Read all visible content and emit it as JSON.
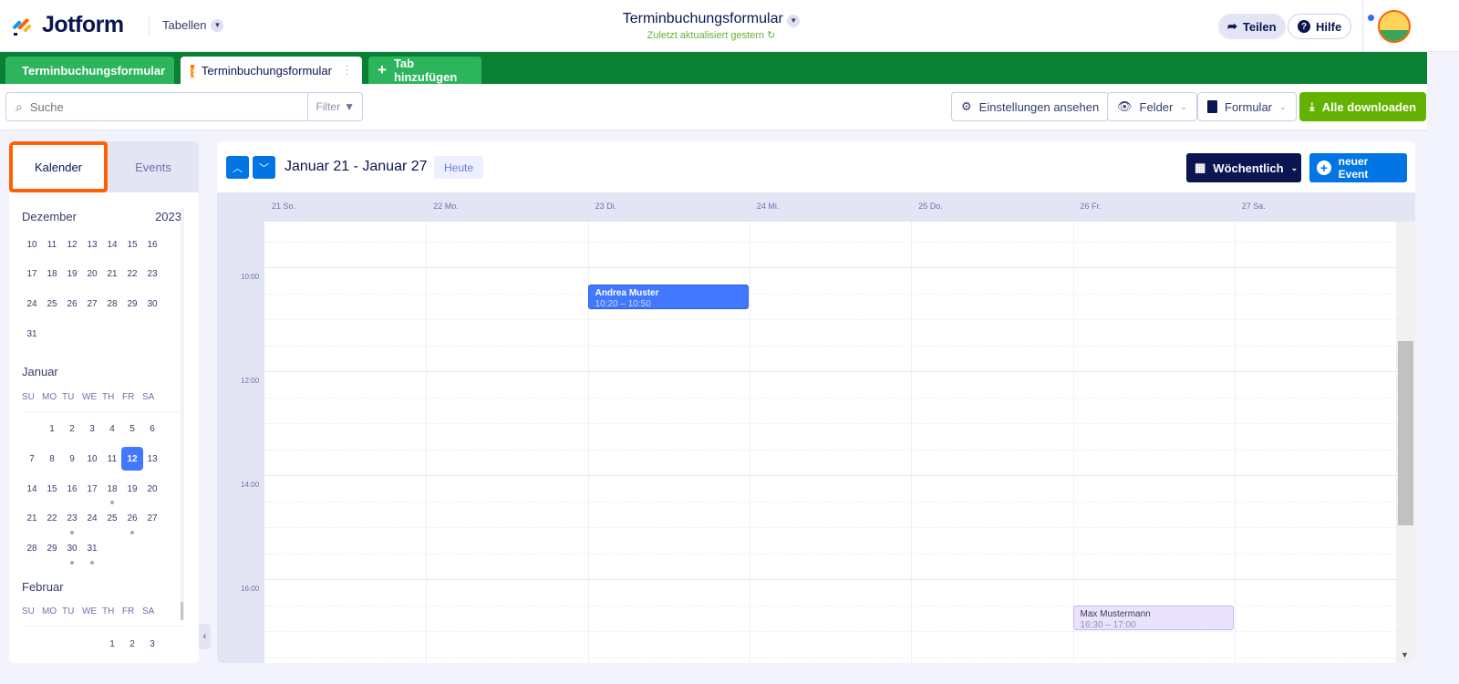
{
  "header": {
    "brand": "Jotform",
    "menu": "Tabellen",
    "title": "Terminbuchungsformular",
    "subtitle": "Zuletzt aktualisiert gestern",
    "share": "Teilen",
    "help": "Hilfe"
  },
  "tabs": [
    {
      "label": "Terminbuchungsformular",
      "icon": "grid-icon"
    },
    {
      "label": "Terminbuchungsformular",
      "icon": "calendar-icon",
      "active": true
    },
    {
      "label": "Tab hinzufügen",
      "icon": "plus-icon"
    }
  ],
  "toolbar": {
    "search_placeholder": "Suche",
    "filter": "Filter",
    "settings": "Einstellungen ansehen",
    "fields": "Felder",
    "form": "Formular",
    "download": "Alle downloaden"
  },
  "sidebar": {
    "tabs": [
      "Kalender",
      "Events"
    ],
    "weekdays": [
      "SU",
      "MO",
      "TU",
      "WE",
      "TH",
      "FR",
      "SA"
    ],
    "months": [
      {
        "name": "Dezember",
        "year": "2023",
        "show_weekdays": false,
        "offset": 0,
        "days": [
          10,
          11,
          12,
          13,
          14,
          15,
          16,
          17,
          18,
          19,
          20,
          21,
          22,
          23,
          24,
          25,
          26,
          27,
          28,
          29,
          30,
          31
        ]
      },
      {
        "name": "Januar",
        "show_weekdays": true,
        "offset": 1,
        "days": [
          1,
          2,
          3,
          4,
          5,
          6,
          7,
          8,
          9,
          10,
          11,
          12,
          13,
          14,
          15,
          16,
          17,
          18,
          19,
          20,
          21,
          22,
          23,
          24,
          25,
          26,
          27,
          28,
          29,
          30,
          31
        ],
        "selected": 12,
        "event_days": [
          18,
          23,
          26,
          30,
          31
        ]
      },
      {
        "name": "Februar",
        "show_weekdays": true,
        "offset": 4,
        "days": [
          1,
          2,
          3
        ]
      }
    ]
  },
  "calendar": {
    "range": "Januar 21 - Januar 27",
    "today": "Heute",
    "view": "Wöchentlich",
    "new_event": "neuer Event",
    "days": [
      "21 So.",
      "22 Mo.",
      "23 Di.",
      "24 Mi.",
      "25 Do.",
      "26 Fr.",
      "27 Sa."
    ],
    "hour_labels": [
      "10:00",
      "12:00",
      "14:00",
      "16:00"
    ],
    "events": [
      {
        "title": "Andrea Muster",
        "time": "10:20 – 10:50",
        "day": 2,
        "start": 10.333,
        "end": 10.833,
        "bg": "#4277ff",
        "fg": "#ffffff",
        "sub": "#c9d7ff"
      },
      {
        "title": "Max Mustermann",
        "time": "16:30 – 17:00",
        "day": 5,
        "start": 16.5,
        "end": 17,
        "bg": "#ebe3fc",
        "fg": "#343c6a",
        "sub": "#8e93b5"
      }
    ]
  },
  "colors": {
    "green": "#0a8034",
    "accent": "#0075e3",
    "orange": "#ff6100",
    "download": "#64b200"
  }
}
